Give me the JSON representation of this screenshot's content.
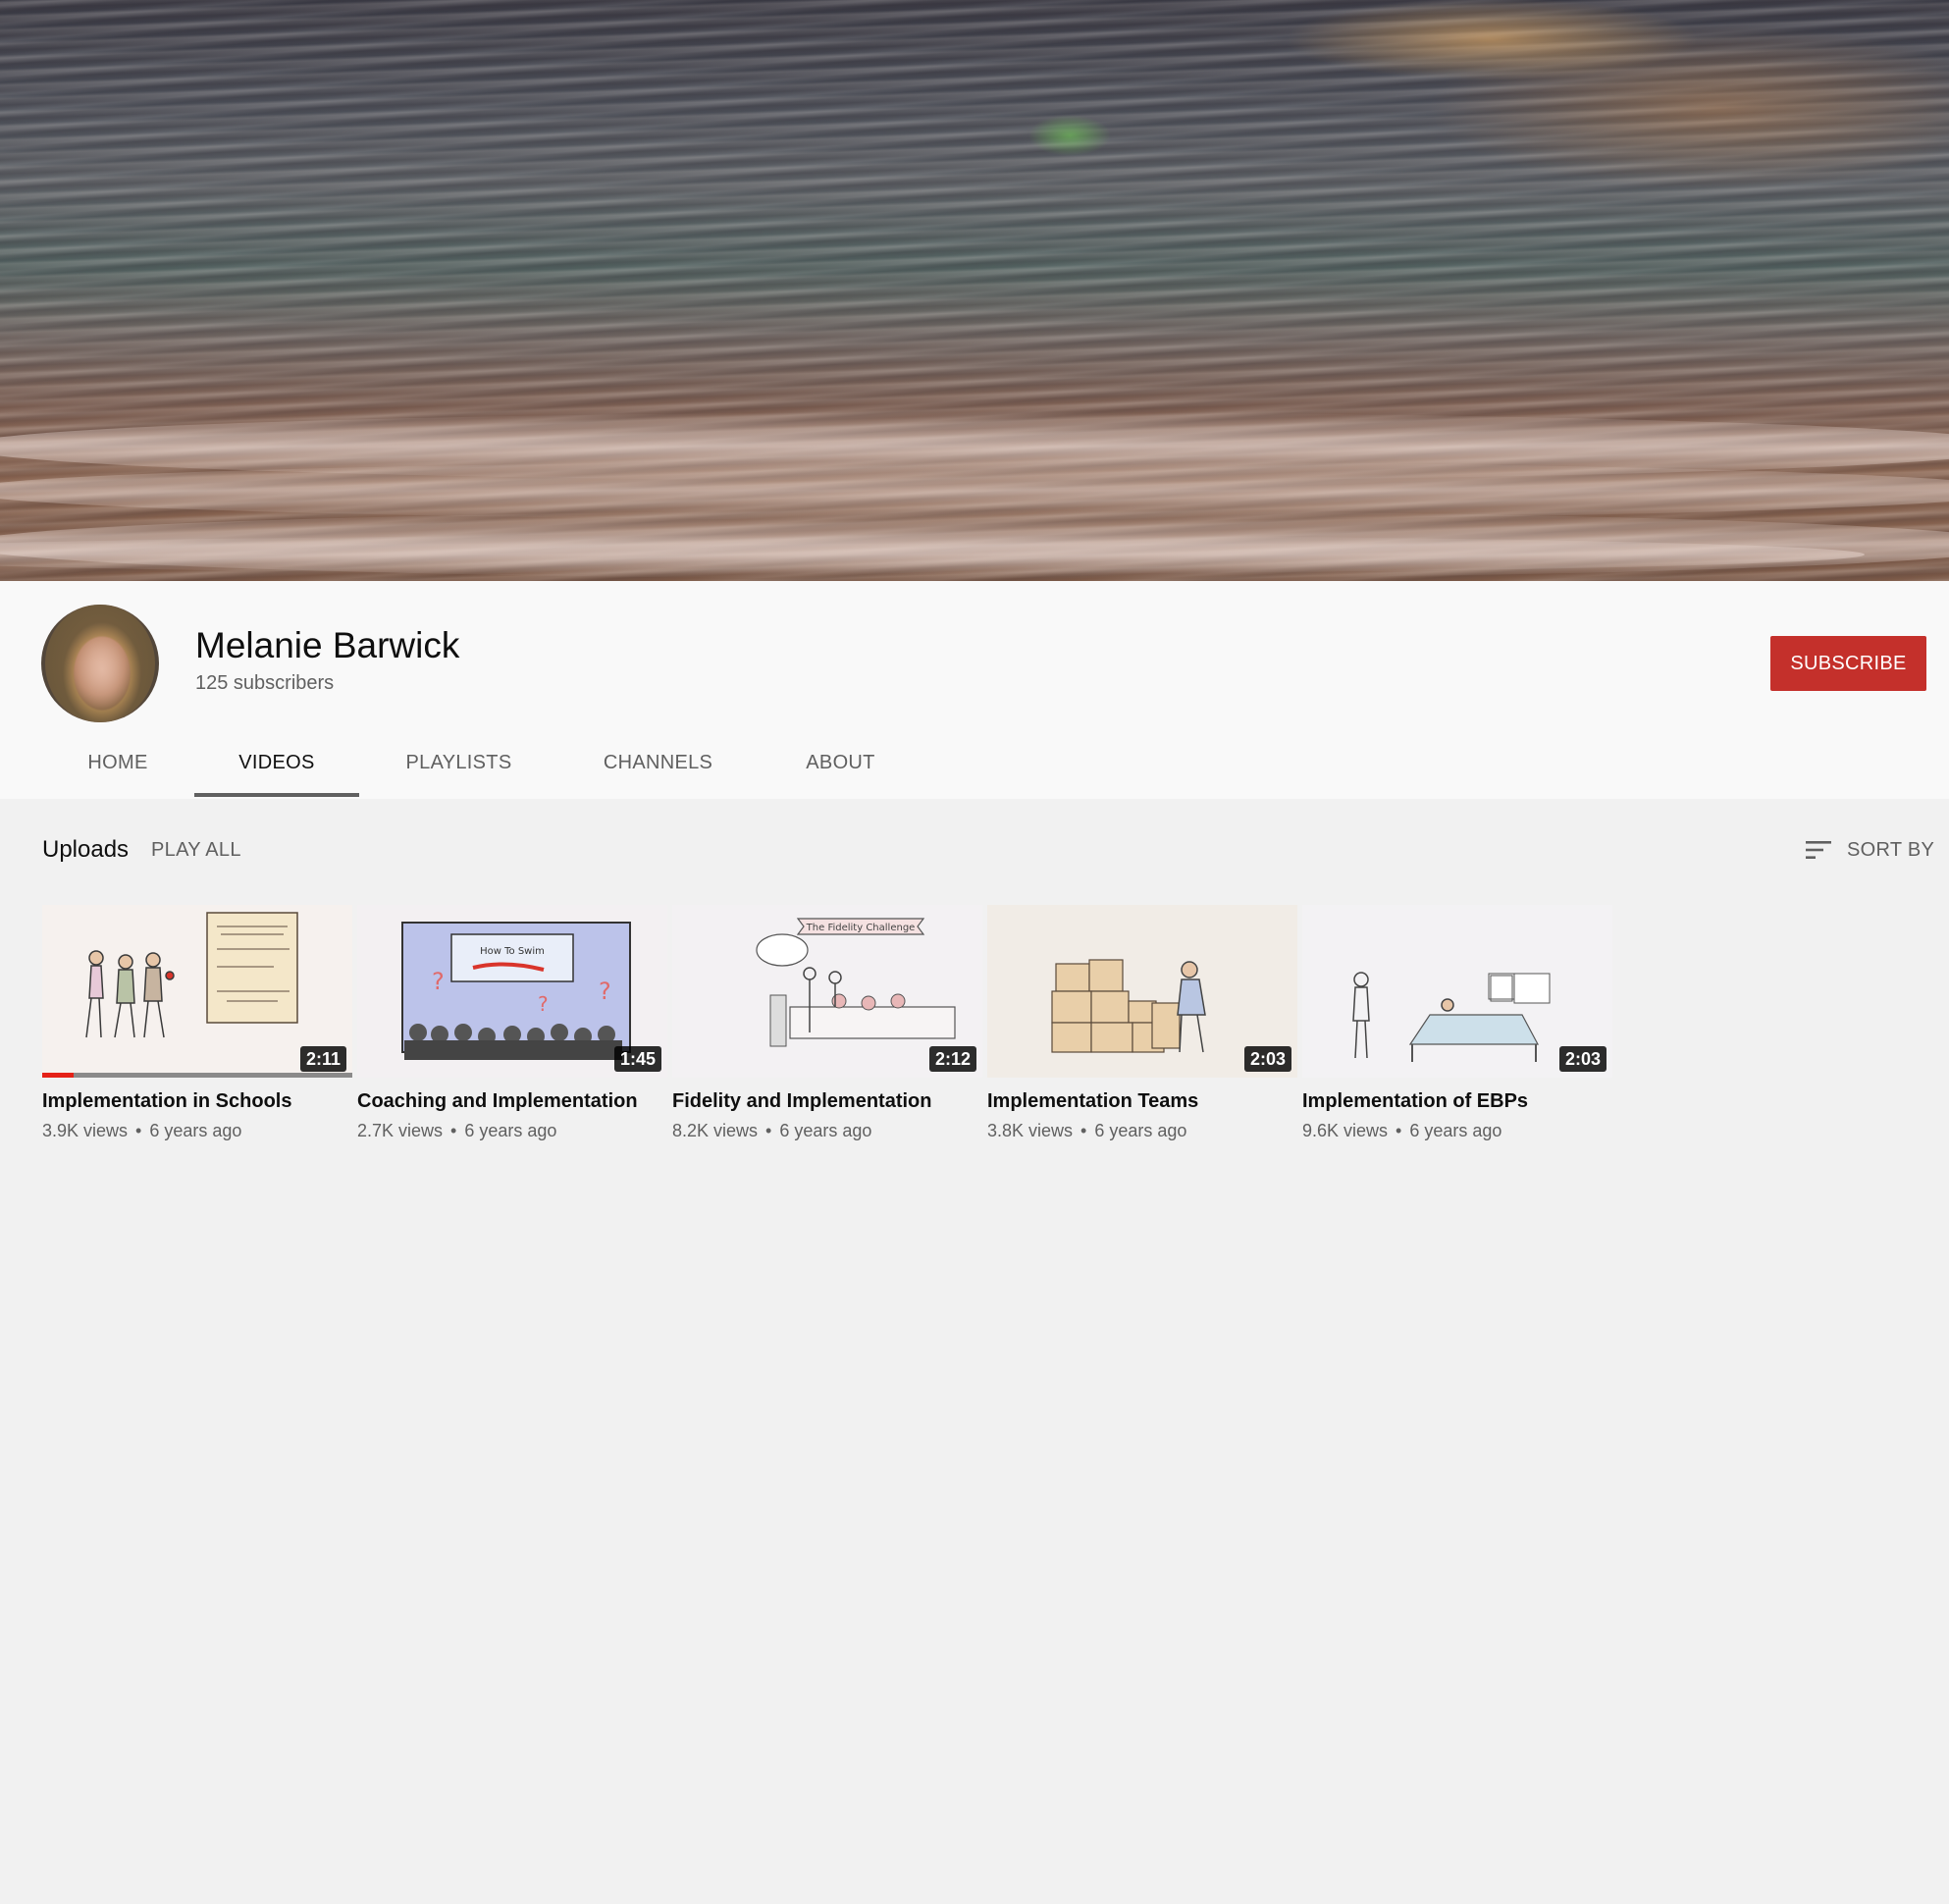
{
  "channel": {
    "name": "Melanie Barwick",
    "subscribers": "125 subscribers",
    "subscribe_label": "SUBSCRIBE"
  },
  "tabs": [
    {
      "label": "HOME"
    },
    {
      "label": "VIDEOS",
      "active": true
    },
    {
      "label": "PLAYLISTS"
    },
    {
      "label": "CHANNELS"
    },
    {
      "label": "ABOUT"
    }
  ],
  "uploads": {
    "label": "Uploads",
    "play_all_label": "PLAY ALL",
    "sort_label": "SORT BY",
    "sort_icon": "sort-icon"
  },
  "videos": [
    {
      "title": "Implementation in Schools",
      "duration": "2:11",
      "views": "3.9K views",
      "age": "6 years ago",
      "watched_fraction": 0.1
    },
    {
      "title": "Coaching and Implementation",
      "duration": "1:45",
      "views": "2.7K views",
      "age": "6 years ago",
      "thumb_text": "How To Swim"
    },
    {
      "title": "Fidelity and Implementation",
      "duration": "2:12",
      "views": "8.2K views",
      "age": "6 years ago",
      "thumb_text": "The Fidelity Challenge"
    },
    {
      "title": "Implementation Teams",
      "duration": "2:03",
      "views": "3.8K views",
      "age": "6 years ago"
    },
    {
      "title": "Implementation of EBPs",
      "duration": "2:03",
      "views": "9.6K views",
      "age": "6 years ago"
    }
  ],
  "colors": {
    "accent_red": "#c4302b",
    "progress_red": "#e52117",
    "page_bg": "#f1f1f1",
    "header_bg": "#f9f9f9"
  }
}
